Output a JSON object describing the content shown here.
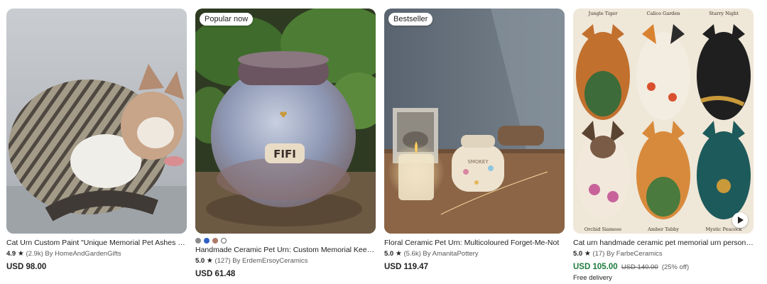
{
  "listings": [
    {
      "title": "Cat Urn Custom Paint \"Unique Memorial Pet Ashes Holder\"",
      "rating": "4.9",
      "reviews": "(2.9k)",
      "shop": "By HomeAndGardenGifts",
      "price": "USD 98.00"
    },
    {
      "badge": "Popular now",
      "title": "Handmade Ceramic Pet Urn: Custom Memorial Keepsake",
      "rating": "5.0",
      "reviews": "(127)",
      "shop": "By ErdemErsoyCeramics",
      "price": "USD 61.48",
      "swatch_colors": [
        "#8a8a8a",
        "#2f5fc4",
        "#b07a6a",
        "#ffffff"
      ],
      "urn_text": "FIFI"
    },
    {
      "badge": "Bestseller",
      "title": "Floral Ceramic Pet Urn: Multicoloured Forget-Me-Not",
      "rating": "5.0",
      "reviews": "(5.6k)",
      "shop": "By AmanitaPottery",
      "price": "USD 119.47",
      "urn_text": "SMOKEY"
    },
    {
      "title": "Cat urn handmade ceramic pet memorial urn personalized",
      "rating": "5.0",
      "reviews": "(17)",
      "shop": "By FarbeCeramics",
      "sale_price": "USD 105.00",
      "original_price": "USD 140.00",
      "discount": "(25% off)",
      "shipping": "Free delivery",
      "cat_labels": [
        "Jungle Tiger",
        "Calico Garden",
        "Starry Night",
        "Orchid Siamese",
        "Amber Tabby",
        "Mystic Peacock"
      ]
    }
  ],
  "icons": {
    "star": "star-icon",
    "play": "play-icon"
  },
  "colors": {
    "sale_green": "#1e7b3c",
    "text": "#222222",
    "muted": "#595959"
  }
}
